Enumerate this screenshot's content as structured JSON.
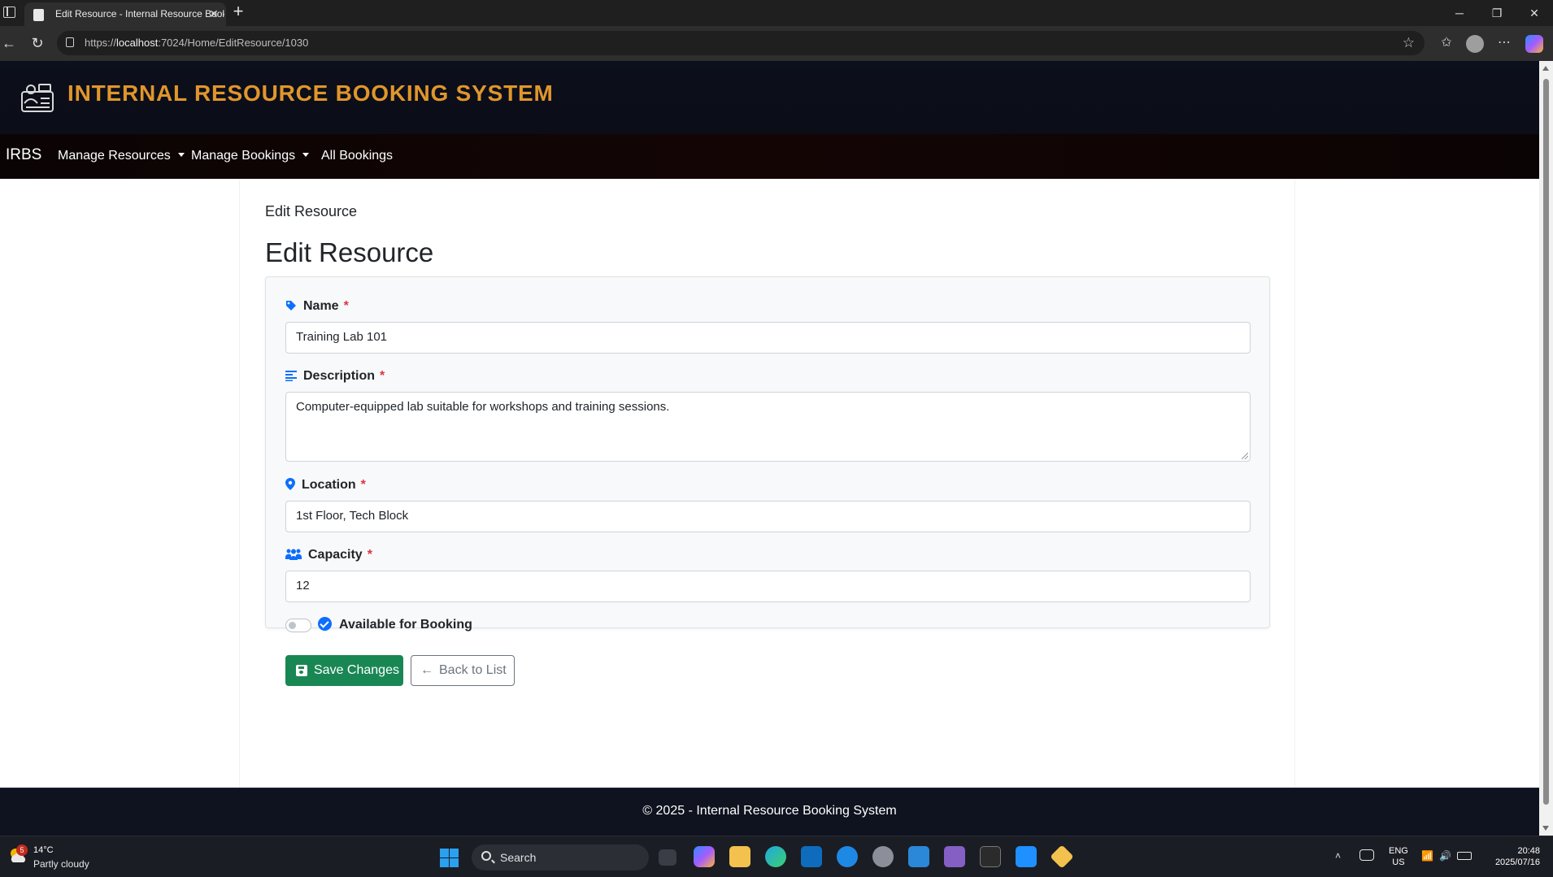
{
  "browser": {
    "tab_title": "Edit Resource - Internal Resource Booking System",
    "url_prefix": "https://",
    "url_host": "localhost",
    "url_rest": ":7024/Home/EditResource/1030"
  },
  "site": {
    "title": "INTERNAL RESOURCE BOOKING SYSTEM",
    "brand": "IRBS",
    "nav": {
      "manage_resources": "Manage Resources",
      "manage_bookings": "Manage Bookings",
      "all_bookings": "All Bookings"
    },
    "footer": "© 2025 - Internal Resource Booking System"
  },
  "page": {
    "breadcrumb": "Edit Resource",
    "heading": "Edit Resource"
  },
  "form": {
    "name": {
      "label": "Name",
      "required_mark": "*",
      "value": "Training Lab 101"
    },
    "description": {
      "label": "Description",
      "required_mark": "*",
      "value": "Computer-equipped lab suitable for workshops and training sessions."
    },
    "location": {
      "label": "Location",
      "required_mark": "*",
      "value": "1st Floor, Tech Block"
    },
    "capacity": {
      "label": "Capacity",
      "required_mark": "*",
      "value": "12"
    },
    "available": {
      "label": "Available for Booking",
      "checked": false
    },
    "save_label": "Save Changes",
    "back_label": "Back to List"
  },
  "taskbar": {
    "weather_badge": "5",
    "weather_temp": "14°C",
    "weather_condition": "Partly cloudy",
    "search_label": "Search",
    "lang_line1": "ENG",
    "lang_line2": "US",
    "time": "20:48",
    "date": "2025/07/16"
  },
  "colors": {
    "header_title": "#e0962b",
    "save_button": "#198754",
    "required": "#dc3545",
    "icon_blue": "#0d6efd"
  }
}
